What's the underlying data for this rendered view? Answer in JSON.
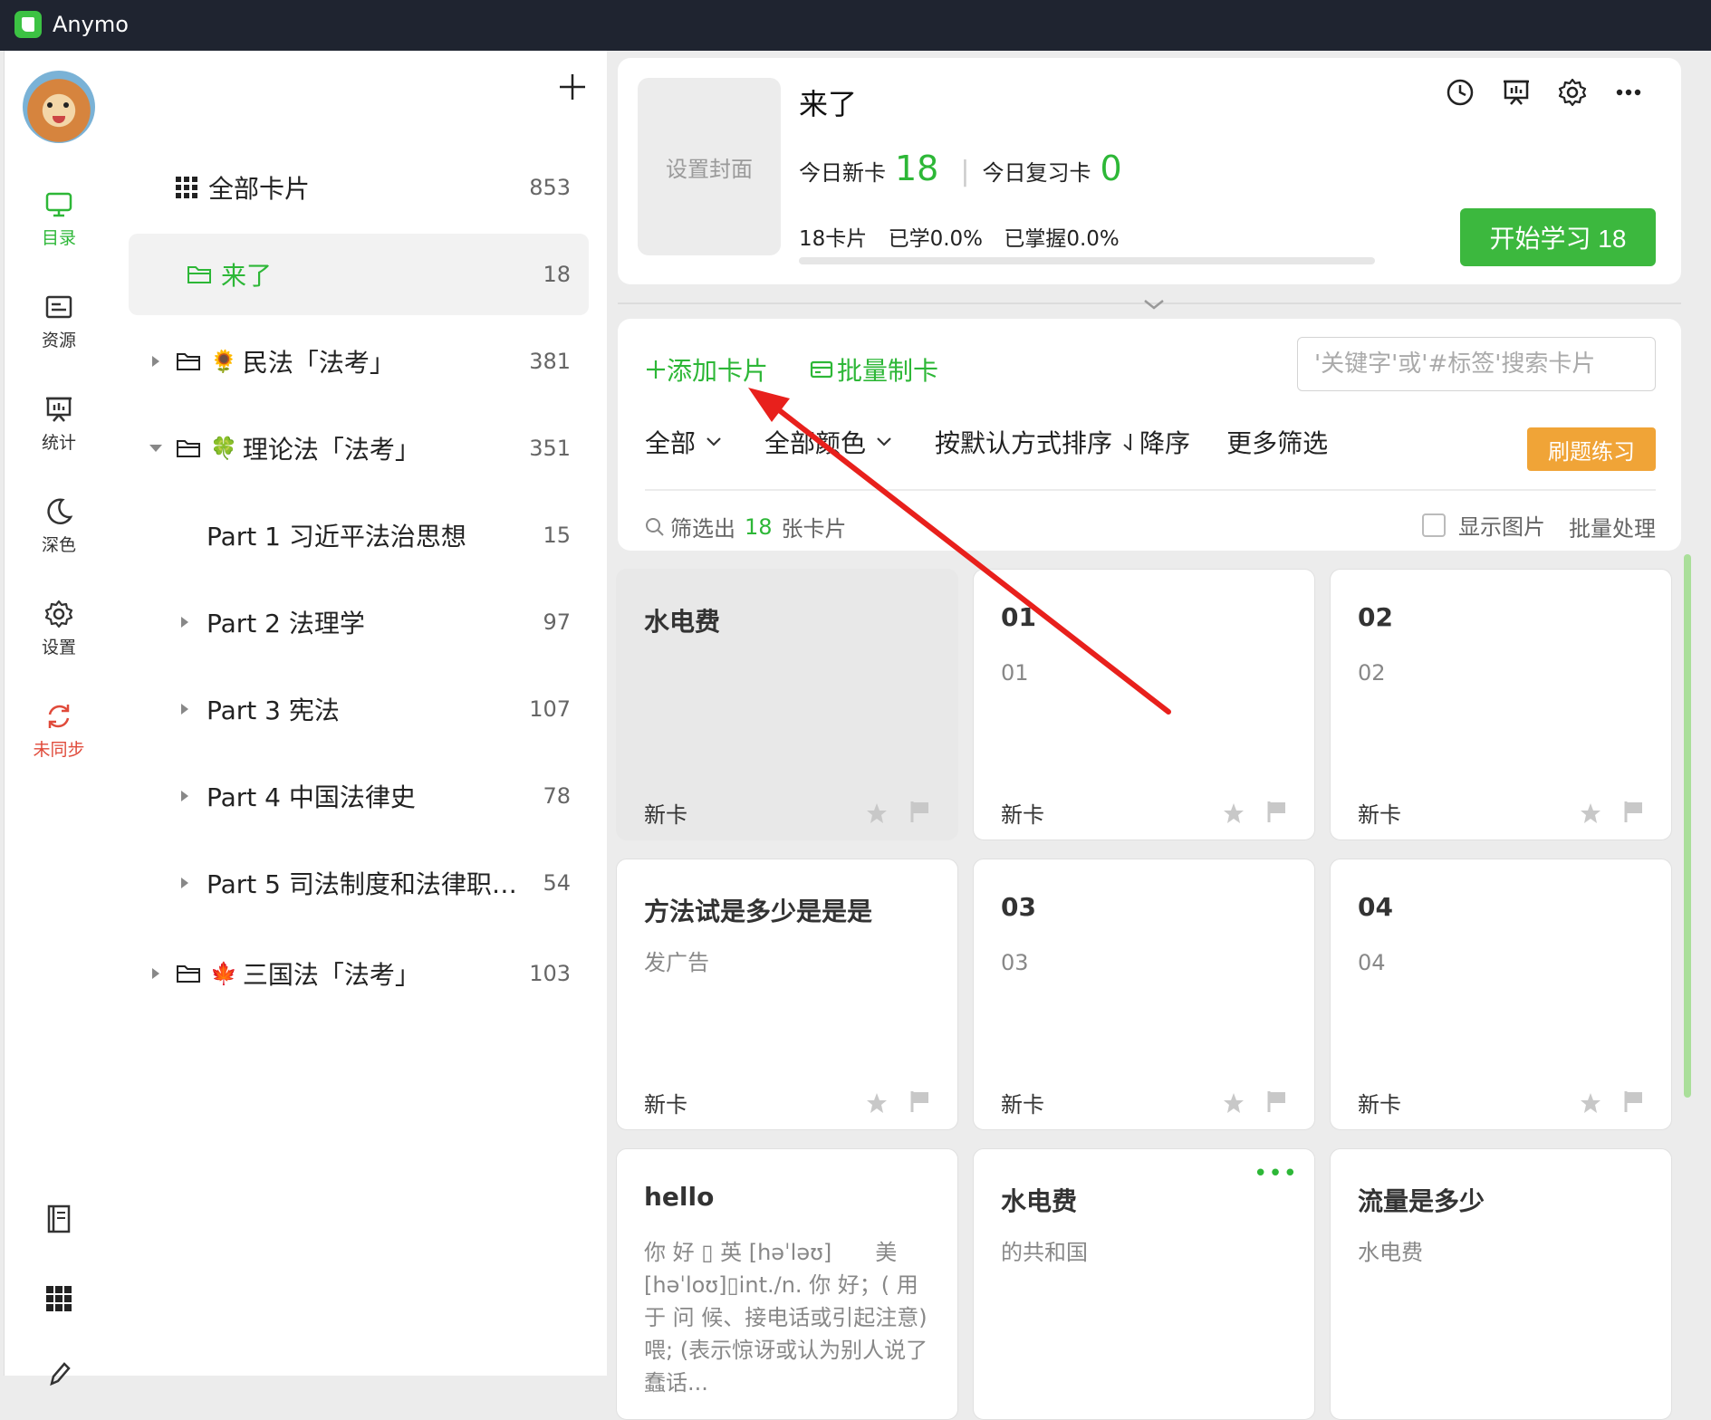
{
  "window": {
    "title": "Anymo"
  },
  "rail": {
    "items": [
      {
        "label": "目录",
        "icon": "monitor-icon",
        "active": true
      },
      {
        "label": "资源",
        "icon": "resource-icon"
      },
      {
        "label": "统计",
        "icon": "presentation-icon"
      },
      {
        "label": "深色",
        "icon": "moon-icon"
      },
      {
        "label": "设置",
        "icon": "gear-icon"
      },
      {
        "label": "未同步",
        "icon": "sync-icon",
        "warn": true
      }
    ],
    "bottom_icons": [
      "book-icon",
      "grid-icon",
      "pen-icon"
    ]
  },
  "tree": {
    "all_cards": {
      "label": "全部卡片",
      "count": "853"
    },
    "rows": [
      {
        "label": "来了",
        "count": "18"
      },
      {
        "label": "民法「法考」",
        "count": "381",
        "emoji": "🌻"
      },
      {
        "label": "理论法「法考」",
        "count": "351",
        "emoji": "🍀"
      },
      {
        "label": "Part 1 习近平法治思想",
        "count": "15"
      },
      {
        "label": "Part 2 法理学",
        "count": "97"
      },
      {
        "label": "Part 3 宪法",
        "count": "107"
      },
      {
        "label": "Part 4 中国法律史",
        "count": "78"
      },
      {
        "label": "Part 5 司法制度和法律职业...",
        "count": "54"
      },
      {
        "label": "三国法「法考」",
        "count": "103",
        "emoji": "🍁"
      }
    ]
  },
  "deck": {
    "cover_label": "设置封面",
    "title": "来了",
    "today_new_label": "今日新卡",
    "today_new": "18",
    "today_review_label": "今日复习卡",
    "today_review": "0",
    "cards_total": "18卡片",
    "learned": "已学0.0%",
    "mastered": "已掌握0.0%",
    "progress": 0.0,
    "start_label": "开始学习 18",
    "icons": [
      "clock-icon",
      "presentation-icon",
      "gear-icon",
      "more-icon"
    ]
  },
  "toolbar": {
    "add_label": "添加卡片",
    "batch_label": "批量制卡",
    "search_placeholder": "'关键字'或'#标签'搜索卡片",
    "filter_all": "全部",
    "filter_color": "全部颜色",
    "sort": "按默认方式排序",
    "order": "降序",
    "more_filters": "更多筛选",
    "practice": "刷题练习",
    "result_prefix": "筛选出",
    "result_count": "18",
    "result_suffix": "张卡片",
    "show_images": "显示图片",
    "batch_process": "批量处理"
  },
  "cards": [
    {
      "title": "水电费",
      "body": "",
      "status": "新卡"
    },
    {
      "title": "01",
      "body": "01",
      "status": "新卡"
    },
    {
      "title": "02",
      "body": "02",
      "status": "新卡"
    },
    {
      "title": "方法试是多少是是是",
      "body": "发广告",
      "status": "新卡"
    },
    {
      "title": "03",
      "body": "03",
      "status": "新卡"
    },
    {
      "title": "04",
      "body": "04",
      "status": "新卡"
    },
    {
      "title": "hello",
      "body": "你 好 ▯ 英 [həˈləʊ]　　美 [həˈloʊ]▯int./n. 你 好；( 用 于 问 候、接电话或引起注意)喂; (表示惊讶或认为别人说了蠢话...",
      "status": ""
    },
    {
      "title": "水电费",
      "body": "的共和国",
      "status": ""
    },
    {
      "title": "流量是多少",
      "body": "水电费",
      "status": ""
    }
  ],
  "colors": {
    "accent": "#2db737",
    "warn": "#e04a3a",
    "practice": "#f0a437",
    "annotation": "#e8201c"
  }
}
